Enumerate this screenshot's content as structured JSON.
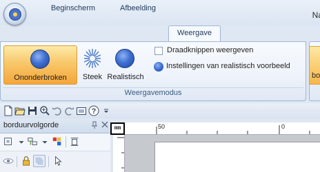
{
  "window": {
    "title": "Na"
  },
  "tabs": [
    {
      "label": "Beginscherm"
    },
    {
      "label": "Afbeelding"
    },
    {
      "label": "Weergave",
      "active": true
    }
  ],
  "ribbon": {
    "buttons": [
      {
        "label": "Ononderbroken",
        "icon": "large-blue-circle-icon",
        "selected": true
      },
      {
        "label": "Steek",
        "icon": "stitch-starburst-icon"
      },
      {
        "label": "Realistisch",
        "icon": "realistic-blue-circle-icon"
      }
    ],
    "checkbox_label": "Draadknippen weergeven",
    "settings_label": "Instellingen van realistisch voorbeeld",
    "group_label": "Weergavemodus",
    "right_button_label": "bo"
  },
  "panel": {
    "title": "borduurvolgorde"
  },
  "ruler": {
    "unit": "mm",
    "labels": [
      "50",
      "0"
    ]
  },
  "colors": {
    "accent": "#f5a63a",
    "ribbon_border": "#9fb6d4",
    "tab_text": "#1e395b"
  }
}
